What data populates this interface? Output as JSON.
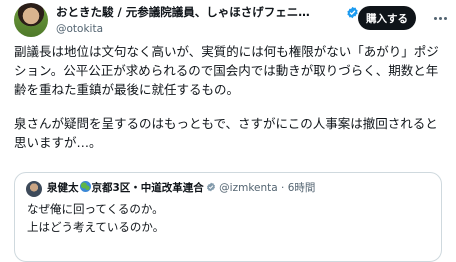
{
  "author": {
    "name": "おときた駿 / 元参議院議員、しゃほさげフェニ…",
    "handle": "@otokita"
  },
  "header": {
    "subscribe_label": "購入する"
  },
  "post": {
    "paragraph1": "副議長は地位は文句なく高いが、実質的には何も権限がない「あがり」ポジション。公平公正が求められるので国会内では動きが取りづらく、期数と年齢を重ねた重鎮が最後に就任するもの。",
    "paragraph2": "泉さんが疑問を呈するのはもっともで、さすがにこの人事案は撤回されると思いますが…。"
  },
  "quote": {
    "name_part1": "泉健太",
    "name_part2": "京都3区・中道改革連合",
    "handle": "@izmkenta",
    "time": "6時間",
    "separator": "·",
    "line1": "なぜ俺に回ってくるのか。",
    "line2": "上はどう考えているのか。"
  },
  "icons": {
    "verified": "verified-badge-icon",
    "more": "more-options-icon",
    "globe": "globe-icon",
    "gov_badge": "government-badge-icon"
  },
  "colors": {
    "verified": "#1d9bf0",
    "subscribe_bg": "#0f1419",
    "muted": "#536471",
    "border": "#cfd9de"
  }
}
